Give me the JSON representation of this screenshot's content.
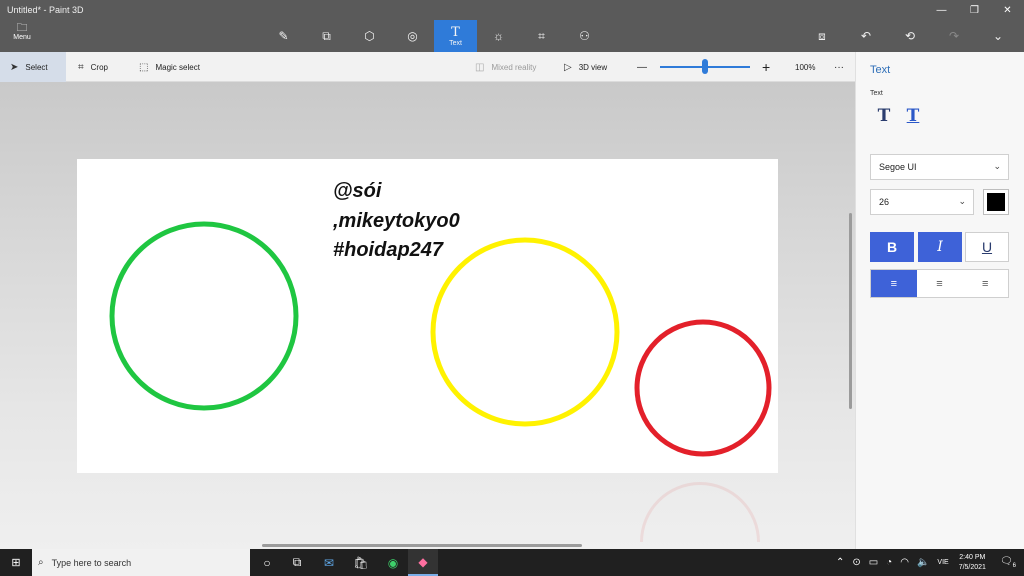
{
  "window": {
    "title": "Untitled* - Paint 3D",
    "controls": [
      "—",
      "❐",
      "✕"
    ]
  },
  "menu": {
    "icon": "folder-icon",
    "label": "Menu"
  },
  "tools": [
    {
      "name": "brushes",
      "icon": "brush-icon",
      "glyph": "✎",
      "label": ""
    },
    {
      "name": "2d-shapes",
      "icon": "2d-shapes-icon",
      "glyph": "⧉",
      "label": ""
    },
    {
      "name": "3d-shapes",
      "icon": "cube-icon",
      "glyph": "⬡",
      "label": ""
    },
    {
      "name": "stickers",
      "icon": "sticker-icon",
      "glyph": "◎",
      "label": ""
    },
    {
      "name": "text",
      "icon": "text-icon",
      "glyph": "T",
      "label": "Text",
      "active": true
    },
    {
      "name": "effects",
      "icon": "effects-icon",
      "glyph": "☼",
      "label": ""
    },
    {
      "name": "canvas",
      "icon": "canvas-icon",
      "glyph": "⌗",
      "label": ""
    },
    {
      "name": "3d-library",
      "icon": "3d-library-icon",
      "glyph": "⚇",
      "label": ""
    }
  ],
  "right_tools": [
    {
      "icon": "paste-icon",
      "glyph": "⧈"
    },
    {
      "icon": "undo-icon",
      "glyph": "↶"
    },
    {
      "icon": "history-icon",
      "glyph": "⟲"
    },
    {
      "icon": "redo-icon",
      "glyph": "↷",
      "disabled": true
    },
    {
      "icon": "chevron-down-icon",
      "glyph": "⌄"
    }
  ],
  "subbar": {
    "select": "Select",
    "crop": "Crop",
    "magic_select": "Magic select",
    "mixed_reality": "Mixed reality",
    "view_3d": "3D view",
    "zoom_minus": "—",
    "zoom_plus": "+",
    "zoom_level": "100%",
    "more": "···",
    "zoom_value_fraction": 0.48
  },
  "canvas": {
    "text_lines": [
      "@sói",
      ",mikeytokyo0",
      "#hoidap247"
    ],
    "circles": [
      {
        "color": "#1fc641"
      },
      {
        "color": "#fff200"
      },
      {
        "color": "#e3202a"
      }
    ]
  },
  "panel": {
    "title": "Text",
    "subtitle": "Text",
    "text_tools": [
      {
        "icon": "2d-text-icon",
        "glyph": "T"
      },
      {
        "icon": "3d-text-icon",
        "glyph": "T"
      }
    ],
    "font": "Segoe UI",
    "size": "26",
    "text_color": "#000000",
    "bold": "B",
    "italic": "I",
    "underline": "U",
    "align_glyph": "≡"
  },
  "taskbar": {
    "search_placeholder": "Type here to search",
    "language": "VIE",
    "time": "2:40 PM",
    "date": "7/5/2021",
    "notifications": "6"
  }
}
